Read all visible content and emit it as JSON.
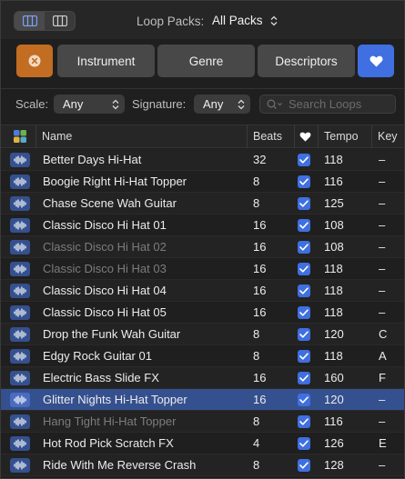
{
  "topbar": {
    "loop_packs_label": "Loop Packs:",
    "loop_packs_value": "All Packs"
  },
  "filters": {
    "instrument": "Instrument",
    "genre": "Genre",
    "descriptors": "Descriptors"
  },
  "scale_row": {
    "scale_label": "Scale:",
    "scale_value": "Any",
    "signature_label": "Signature:",
    "signature_value": "Any",
    "search_placeholder": "Search Loops"
  },
  "table": {
    "columns": {
      "name": "Name",
      "beats": "Beats",
      "tempo": "Tempo",
      "key": "Key"
    },
    "rows": [
      {
        "name": "Better Days Hi-Hat",
        "beats": "32",
        "tempo": "118",
        "key": "–",
        "dim": false,
        "selected": false
      },
      {
        "name": "Boogie Right Hi-Hat Topper",
        "beats": "8",
        "tempo": "116",
        "key": "–",
        "dim": false,
        "selected": false
      },
      {
        "name": "Chase Scene Wah Guitar",
        "beats": "8",
        "tempo": "125",
        "key": "–",
        "dim": false,
        "selected": false
      },
      {
        "name": "Classic Disco Hi Hat 01",
        "beats": "16",
        "tempo": "108",
        "key": "–",
        "dim": false,
        "selected": false
      },
      {
        "name": "Classic Disco Hi Hat 02",
        "beats": "16",
        "tempo": "108",
        "key": "–",
        "dim": true,
        "selected": false
      },
      {
        "name": "Classic Disco Hi Hat 03",
        "beats": "16",
        "tempo": "118",
        "key": "–",
        "dim": true,
        "selected": false
      },
      {
        "name": "Classic Disco Hi Hat 04",
        "beats": "16",
        "tempo": "118",
        "key": "–",
        "dim": false,
        "selected": false
      },
      {
        "name": "Classic Disco Hi Hat 05",
        "beats": "16",
        "tempo": "118",
        "key": "–",
        "dim": false,
        "selected": false
      },
      {
        "name": "Drop the Funk Wah Guitar",
        "beats": "8",
        "tempo": "120",
        "key": "C",
        "dim": false,
        "selected": false
      },
      {
        "name": "Edgy Rock Guitar 01",
        "beats": "8",
        "tempo": "118",
        "key": "A",
        "dim": false,
        "selected": false
      },
      {
        "name": "Electric Bass Slide FX",
        "beats": "16",
        "tempo": "160",
        "key": "F",
        "dim": false,
        "selected": false
      },
      {
        "name": "Glitter Nights Hi-Hat Topper",
        "beats": "16",
        "tempo": "120",
        "key": "–",
        "dim": false,
        "selected": true
      },
      {
        "name": "Hang Tight Hi-Hat Topper",
        "beats": "8",
        "tempo": "116",
        "key": "–",
        "dim": true,
        "selected": false
      },
      {
        "name": "Hot Rod Pick Scratch FX",
        "beats": "4",
        "tempo": "126",
        "key": "E",
        "dim": false,
        "selected": false
      },
      {
        "name": "Ride With Me Reverse Crash",
        "beats": "8",
        "tempo": "128",
        "key": "–",
        "dim": false,
        "selected": false
      }
    ]
  },
  "colors": {
    "accent": "#3f6fe0",
    "reset_orange": "#c26d22",
    "selection": "#35508e"
  }
}
